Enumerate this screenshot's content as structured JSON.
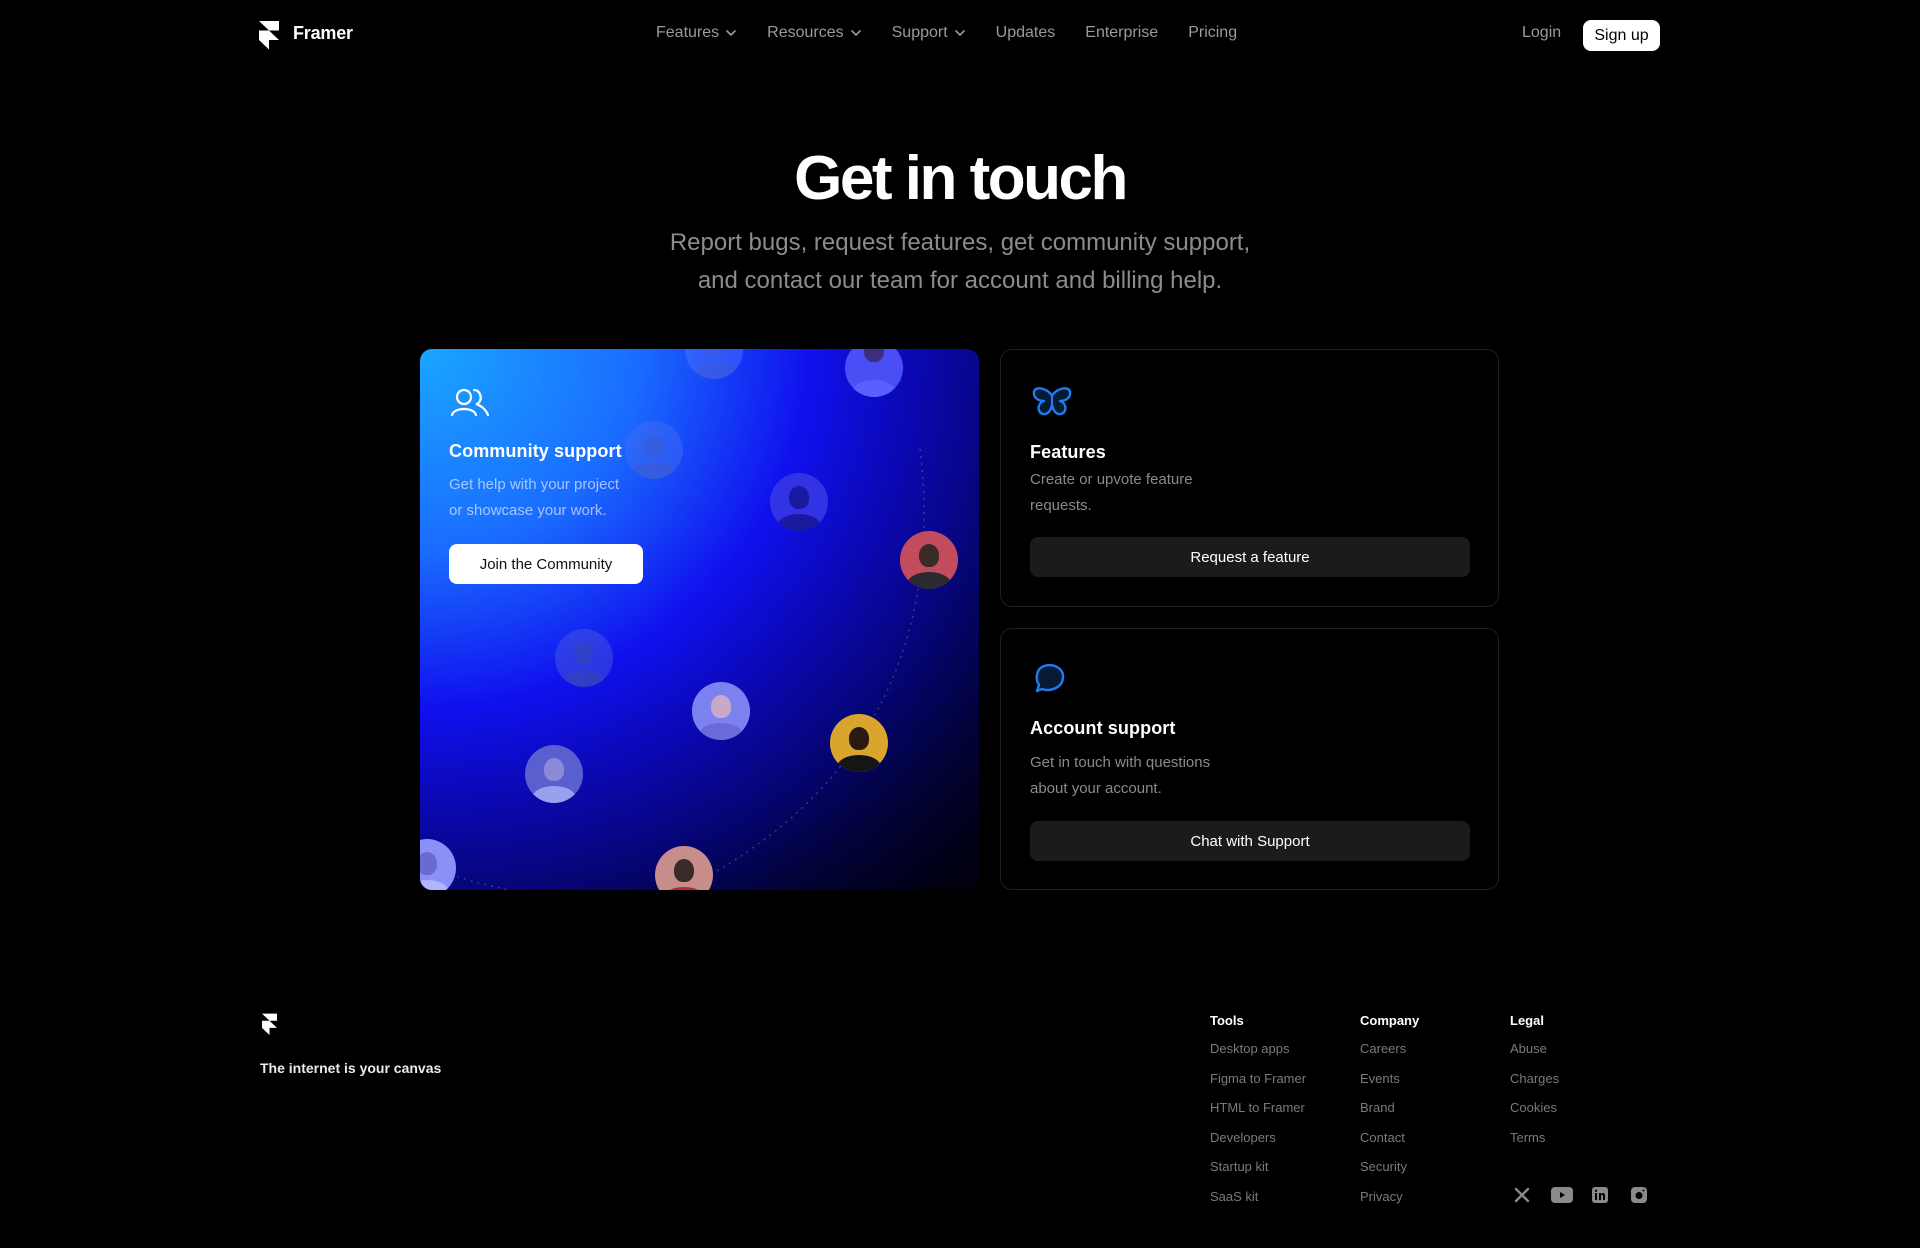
{
  "header": {
    "brand": "Framer",
    "nav": [
      {
        "label": "Features",
        "dropdown": true
      },
      {
        "label": "Resources",
        "dropdown": true
      },
      {
        "label": "Support",
        "dropdown": true
      },
      {
        "label": "Updates",
        "dropdown": false
      },
      {
        "label": "Enterprise",
        "dropdown": false
      },
      {
        "label": "Pricing",
        "dropdown": false
      }
    ],
    "login": "Login",
    "signup": "Sign up"
  },
  "hero": {
    "title": "Get in touch",
    "subtitle_line1": "Report bugs, request features, get community support,",
    "subtitle_line2": "and contact our team for account and billing help."
  },
  "cards": {
    "community": {
      "icon": "users-icon",
      "title": "Community support",
      "desc_line1": "Get help with your project",
      "desc_line2": "or showcase your work.",
      "button": "Join the Community"
    },
    "features": {
      "icon": "butterfly-icon",
      "title": "Features",
      "desc_line1": "Create or upvote feature",
      "desc_line2": "requests.",
      "button": "Request a feature"
    },
    "account": {
      "icon": "chat-bubble-icon",
      "title": "Account support",
      "desc_line1": "Get in touch with questions",
      "desc_line2": "about your account.",
      "button": "Chat with Support"
    }
  },
  "footer": {
    "tagline": "The internet is your canvas",
    "columns": [
      {
        "title": "Tools",
        "links": [
          "Desktop apps",
          "Figma to Framer",
          "HTML to Framer",
          "Developers",
          "Startup kit",
          "SaaS kit"
        ]
      },
      {
        "title": "Company",
        "links": [
          "Careers",
          "Events",
          "Brand",
          "Contact",
          "Security",
          "Privacy"
        ]
      },
      {
        "title": "Legal",
        "links": [
          "Abuse",
          "Charges",
          "Cookies",
          "Terms"
        ]
      }
    ],
    "social": [
      "x-icon",
      "youtube-icon",
      "linkedin-icon",
      "instagram-icon"
    ]
  },
  "colors": {
    "background": "#000000",
    "accent_blue": "#1e7bf0",
    "muted_text": "#8a8a8a",
    "dark_button": "#1b1b1b"
  }
}
